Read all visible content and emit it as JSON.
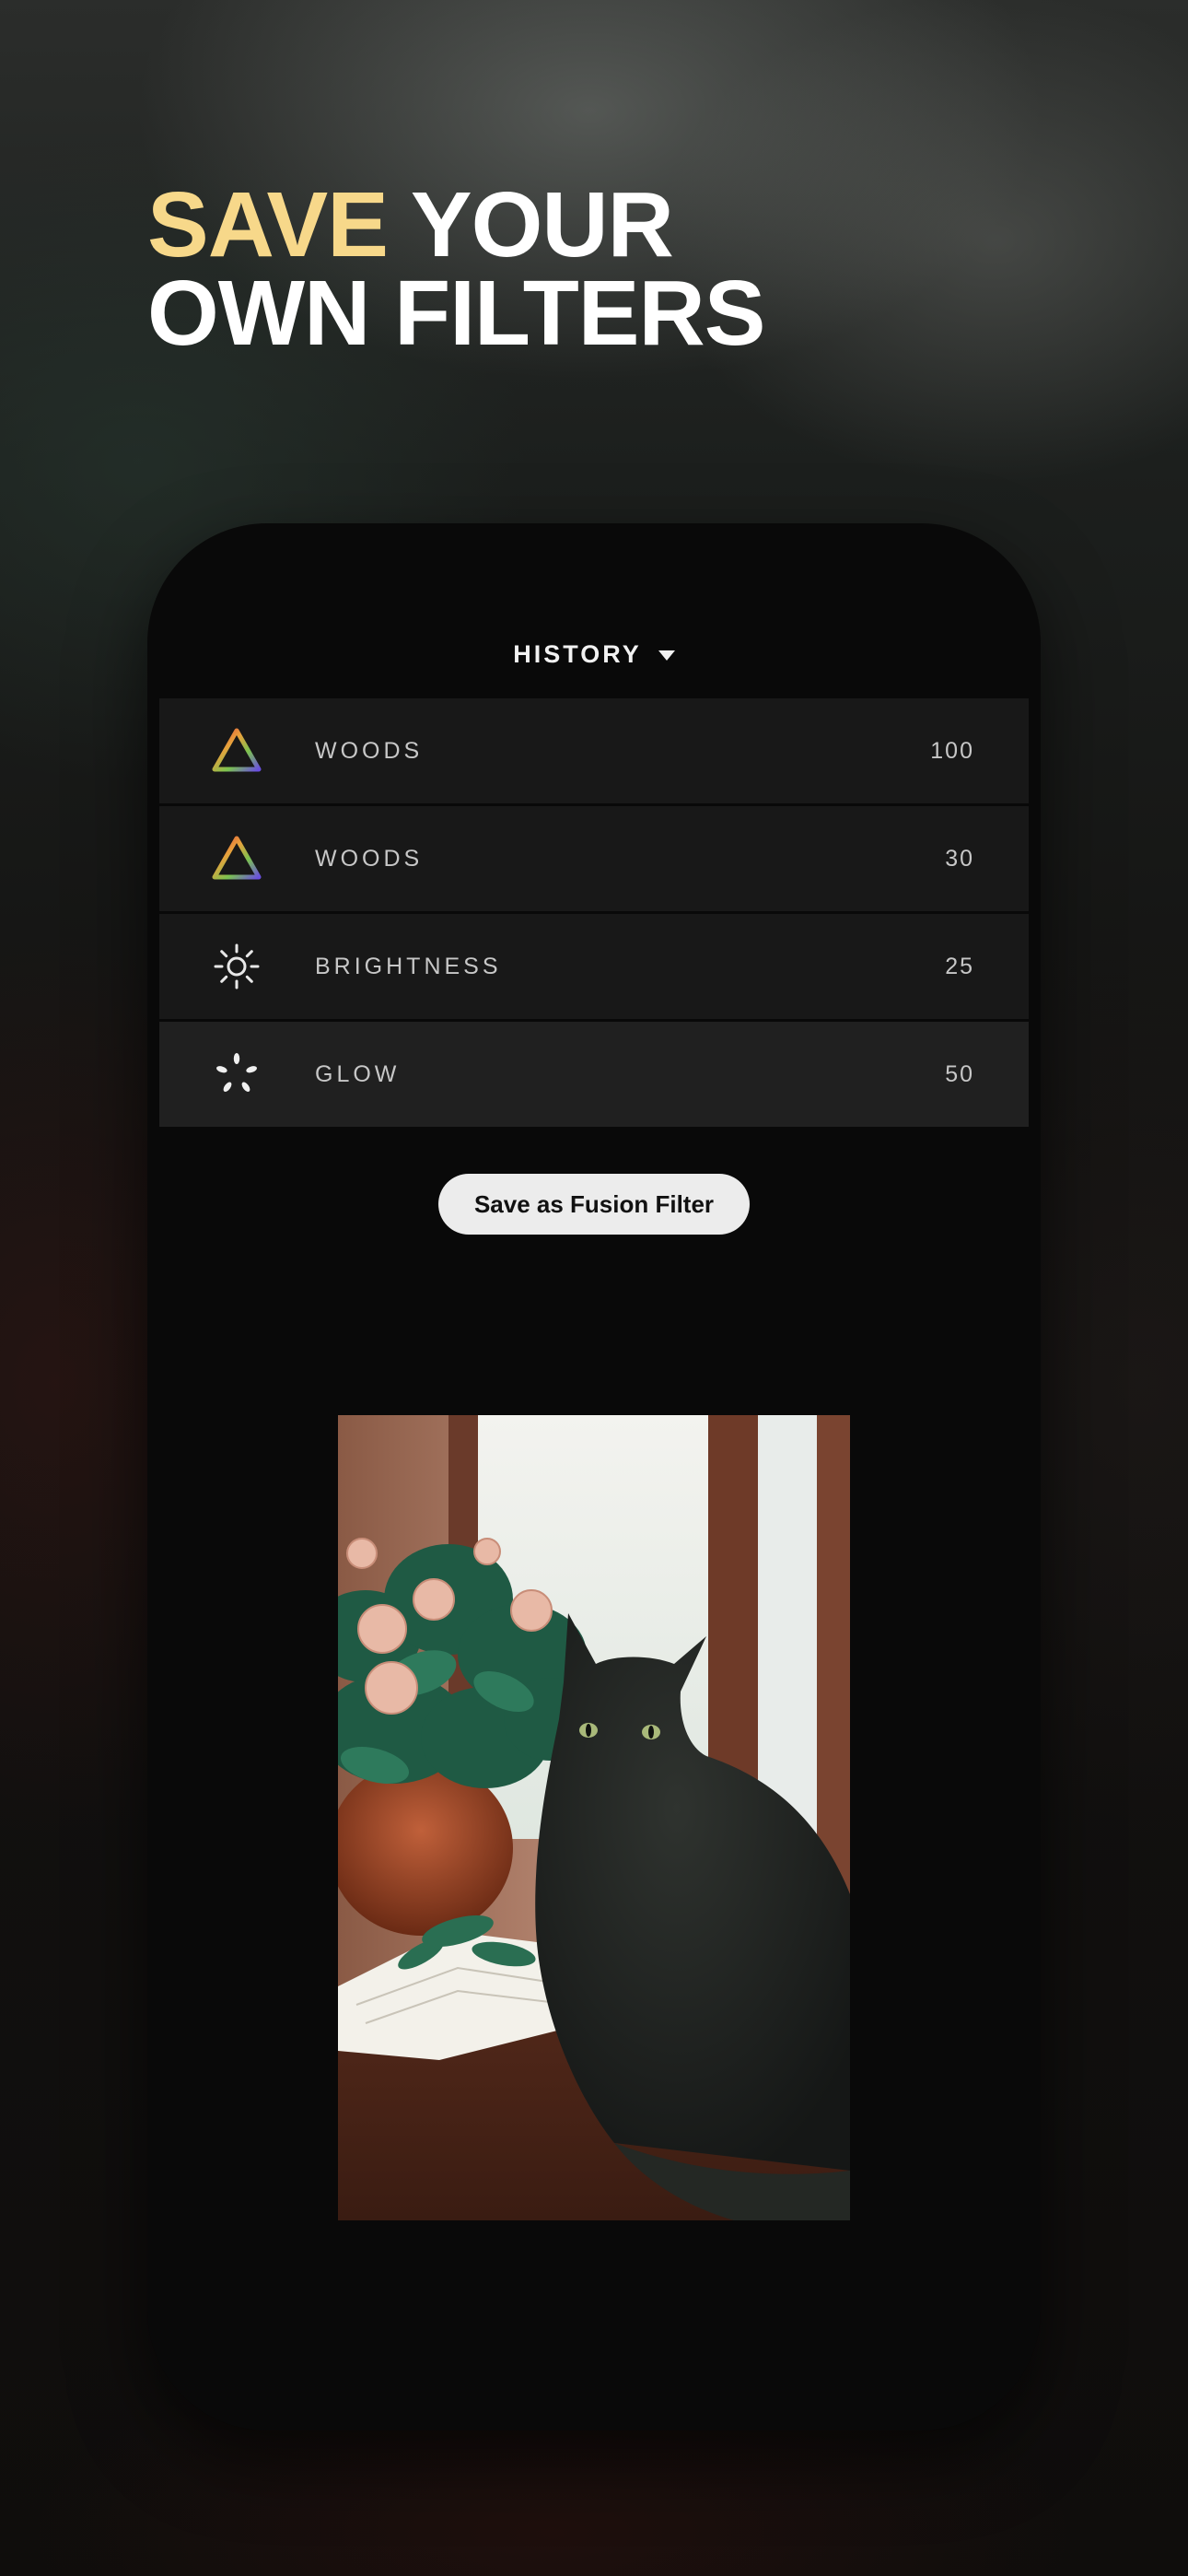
{
  "headline": {
    "accent": "SAVE",
    "rest_line1": " YOUR",
    "line2": "OWN FILTERS"
  },
  "history": {
    "title": "HISTORY",
    "dropdown_icon": "caret-down-icon",
    "items": [
      {
        "icon": "prism-triangle-icon",
        "label": "WOODS",
        "value": "100"
      },
      {
        "icon": "prism-triangle-icon",
        "label": "WOODS",
        "value": "30"
      },
      {
        "icon": "sun-icon",
        "label": "BRIGHTNESS",
        "value": "25"
      },
      {
        "icon": "glow-icon",
        "label": "GLOW",
        "value": "50"
      }
    ]
  },
  "actions": {
    "save_fusion_label": "Save as Fusion Filter"
  },
  "photo": {
    "subject": "black cat on windowsill with roses"
  },
  "colors": {
    "accent": "#f7d88a",
    "phone_bg": "#090909",
    "row_bg": "#181818",
    "row_active_bg": "#202020",
    "button_bg": "#ececec"
  }
}
